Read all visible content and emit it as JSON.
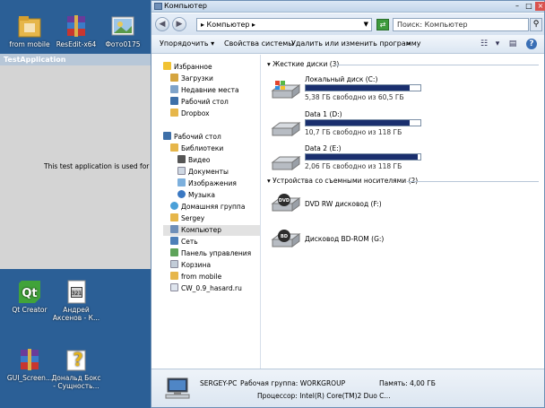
{
  "desktop": {
    "icons": [
      {
        "label": "from mobile",
        "icon": "folder-icon"
      },
      {
        "label": "ResEdit-x64",
        "icon": "winrar-archive-icon"
      },
      {
        "label": "Фото0175",
        "icon": "photo-icon"
      },
      {
        "label": "Qt Creator",
        "icon": "qt-creator-icon"
      },
      {
        "label": "Андрей Аксенов - К...",
        "icon": "video-file-icon"
      },
      {
        "label": "GUI_Screen...",
        "icon": "winrar-archive-icon"
      },
      {
        "label": "Дональд Бокс - Сущность...",
        "icon": "help-file-icon"
      }
    ]
  },
  "test_app": {
    "title": "TestApplication",
    "text": "This test application is used for wind"
  },
  "explorer": {
    "title": "Компьютер",
    "address": "▸ Компьютер ▸",
    "search_placeholder": "Поиск: Компьютер",
    "toolbar": {
      "organize": "Упорядочить",
      "system_properties": "Свойства системы",
      "uninstall": "Удалить или изменить программу",
      "more": "»"
    },
    "nav": {
      "favorites": "Избранное",
      "downloads": "Загрузки",
      "recent": "Недавние места",
      "desktop": "Рабочий стол",
      "dropbox": "Dropbox",
      "desktop_root": "Рабочий стол",
      "libraries": "Библиотеки",
      "video": "Видео",
      "documents": "Документы",
      "images": "Изображения",
      "music": "Музыка",
      "homegroup": "Домашняя группа",
      "sergey": "Sergey",
      "computer": "Компьютер",
      "network": "Сеть",
      "control_panel": "Панель управления",
      "recycle": "Корзина",
      "from_mobile": "from mobile",
      "cw": "CW_0.9_hasard.ru"
    },
    "hard_drives_header": "Жесткие диски (3)",
    "drives": [
      {
        "name": "Локальный диск (C:)",
        "free": "5,38 ГБ свободно из 60,5 ГБ",
        "used_fraction": 0.91
      },
      {
        "name": "Data 1 (D:)",
        "free": "10,7 ГБ свободно из 118 ГБ",
        "used_fraction": 0.91
      },
      {
        "name": "Data 2 (E:)",
        "free": "2,06 ГБ свободно из 118 ГБ",
        "used_fraction": 0.98
      }
    ],
    "removable_header": "Устройства со съемными носителями (2)",
    "removable": [
      {
        "name": "DVD RW дисковод (F:)",
        "badge": "DVD"
      },
      {
        "name": "Дисковод BD-ROM (G:)",
        "badge": "BD"
      }
    ],
    "details": {
      "pc_name": "SERGEY-PC",
      "workgroup": "Рабочая группа: WORKGROUP",
      "memory": "Память: 4,00 ГБ",
      "processor": "Процессор: Intel(R) Core(TM)2 Duo C..."
    }
  },
  "colors": {
    "desktop": "#2b5f96",
    "drive_bar": "#1a2f6e",
    "accent": "#3d9a3d"
  }
}
